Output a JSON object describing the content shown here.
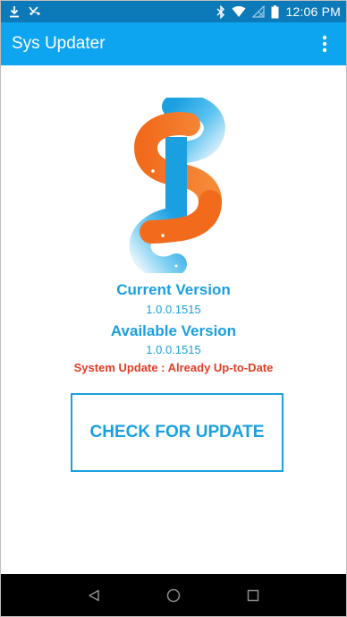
{
  "status_bar": {
    "time": "12:06 PM",
    "icons_left": [
      "download-icon",
      "missed-call-icon"
    ],
    "icons_right": [
      "bluetooth-icon",
      "wifi-icon",
      "no-sim-icon",
      "battery-icon"
    ]
  },
  "app_bar": {
    "title": "Sys Updater",
    "menu_icon": "more-vert-icon"
  },
  "main": {
    "current_version_label": "Current Version",
    "current_version_value": "1.0.0.1515",
    "available_version_label": "Available Version",
    "available_version_value": "1.0.0.1515",
    "status_message": "System Update : Already Up-to-Date",
    "check_button_label": "CHECK FOR UPDATE"
  },
  "nav_bar": {
    "buttons": [
      "back-icon",
      "home-icon",
      "recents-icon"
    ]
  },
  "colors": {
    "status_bar": "#0c7ab8",
    "app_bar": "#0da4f0",
    "accent_blue": "#1a9fe0",
    "status_red": "#e53b24",
    "logo_orange": "#f26b1d",
    "nav_bar": "#000000"
  }
}
